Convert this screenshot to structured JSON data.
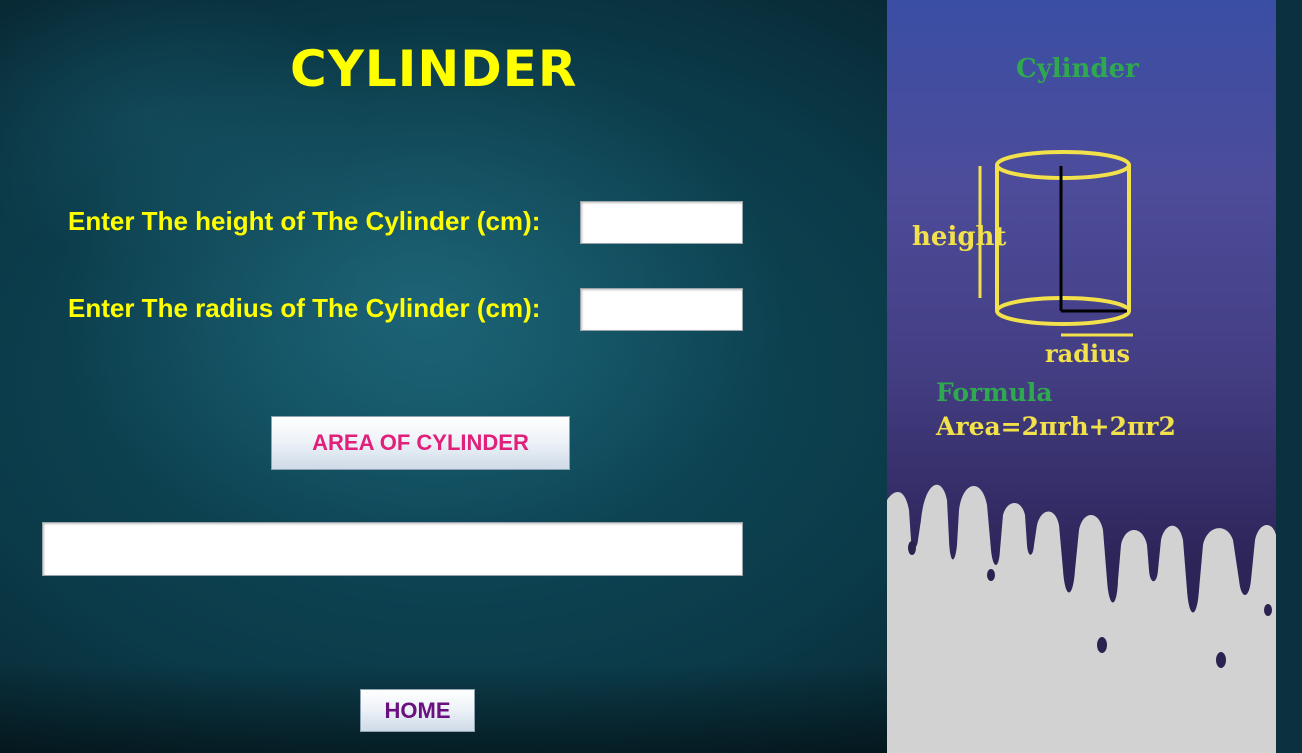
{
  "window": {
    "title": "CYLINDER"
  },
  "form": {
    "height_label": "Enter The height of The Cylinder (cm):",
    "height_value": "",
    "radius_label": "Enter The radius of The Cylinder (cm):",
    "radius_value": "",
    "compute_button": "AREA OF CYLINDER",
    "result_value": "",
    "home_button": "HOME"
  },
  "info_panel": {
    "title": "Cylinder",
    "diagram": {
      "height_label": "height",
      "radius_label": "radius"
    },
    "formula_heading": "Formula",
    "formula": "Area=2πrh+2πr2"
  },
  "colors": {
    "title": "#ffff00",
    "labels": "#ffff00",
    "compute_button_text": "#e0207a",
    "home_button_text": "#6a1080",
    "info_green": "#2fa84f",
    "info_yellow": "#f2e14a"
  }
}
